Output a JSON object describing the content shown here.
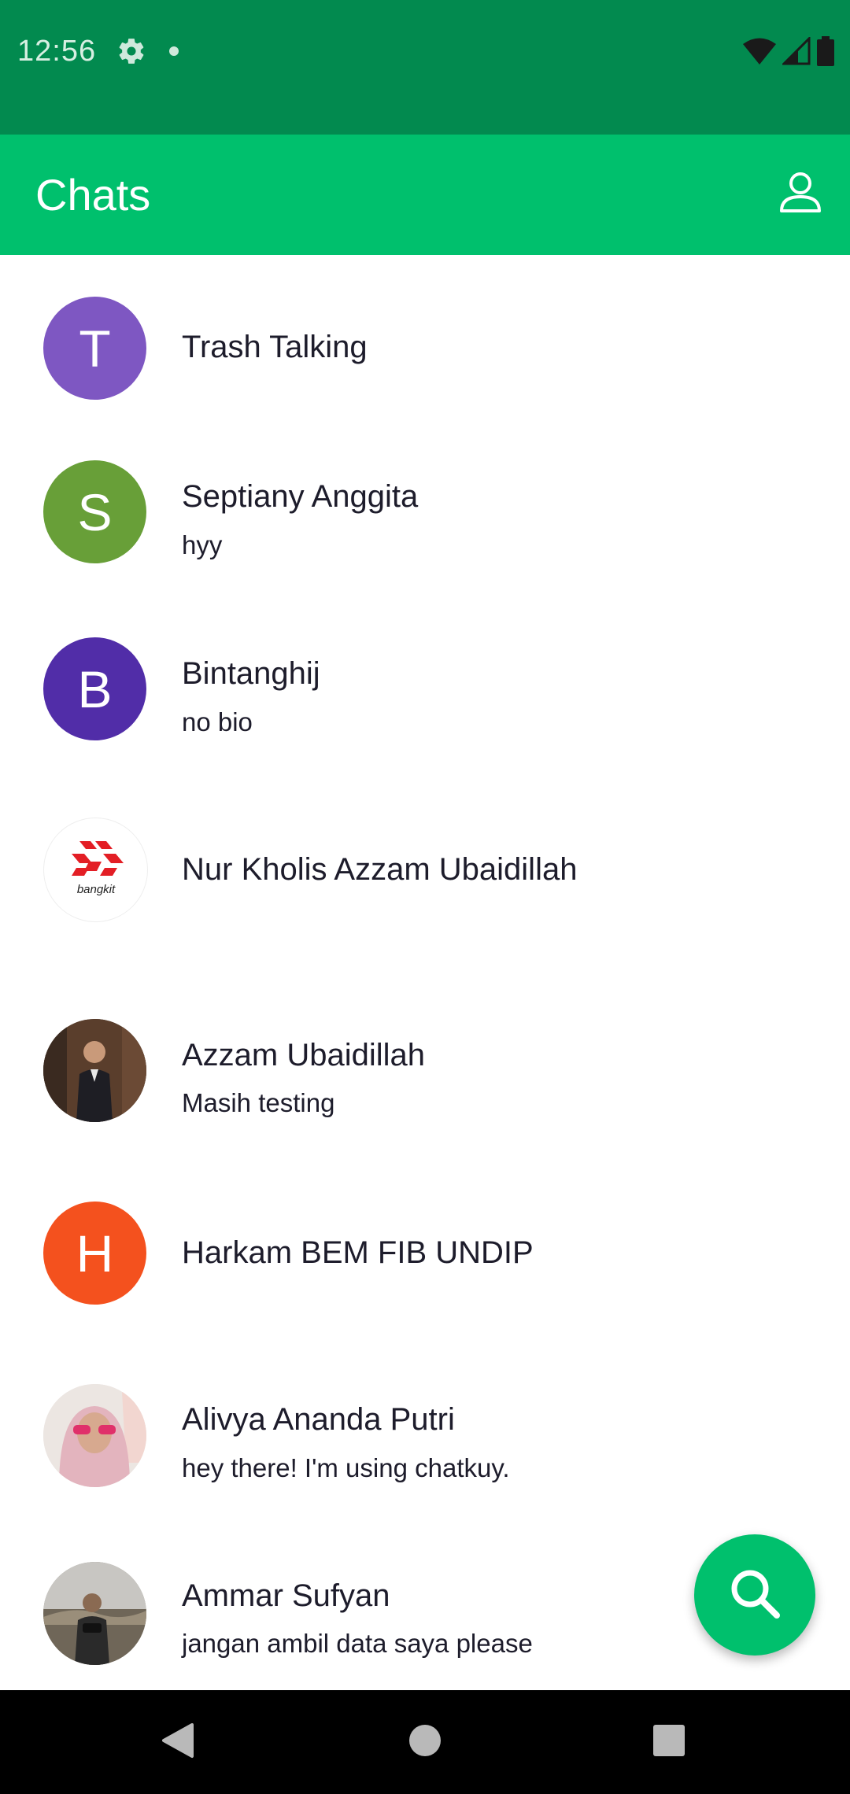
{
  "status_bar": {
    "time": "12:56",
    "icons": [
      "settings-gear-icon",
      "notification-dot-icon",
      "wifi-icon",
      "cell-signal-icon",
      "battery-icon"
    ]
  },
  "app_bar": {
    "title": "Chats",
    "profile_icon": "person-outline-icon"
  },
  "chats": [
    {
      "name": "Trash Talking",
      "subtitle": "",
      "avatar_letter": "T",
      "avatar_color": "#7e57c2"
    },
    {
      "name": "Septiany Anggita",
      "subtitle": "hyy",
      "avatar_letter": "S",
      "avatar_color": "#689f38"
    },
    {
      "name": "Bintanghij",
      "subtitle": "no bio",
      "avatar_letter": "B",
      "avatar_color": "#512da8"
    },
    {
      "name": "Nur Kholis Azzam Ubaidillah",
      "subtitle": "",
      "avatar_logo_text": "bangkit",
      "avatar_color": "#ffffff"
    },
    {
      "name": "Azzam Ubaidillah",
      "subtitle": "Masih testing",
      "avatar_photo": "person-in-suit-photo"
    },
    {
      "name": "Harkam BEM FIB UNDIP",
      "subtitle": "",
      "avatar_letter": "H",
      "avatar_color": "#f4511e"
    },
    {
      "name": "Alivya Ananda Putri",
      "subtitle": "hey there! I'm using chatkuy.",
      "avatar_photo": "person-with-hijab-photo"
    },
    {
      "name": "Ammar Sufyan",
      "subtitle": "jangan ambil data saya please",
      "avatar_photo": "person-outdoors-photo"
    }
  ],
  "fab": {
    "icon": "search-icon",
    "color": "#00c06d"
  },
  "nav_bar": {
    "icons": [
      "back-triangle-icon",
      "home-circle-icon",
      "recents-square-icon"
    ]
  },
  "colors": {
    "status_bar": "#028a4f",
    "app_bar": "#00c06d",
    "text": "#1d1c2b"
  }
}
